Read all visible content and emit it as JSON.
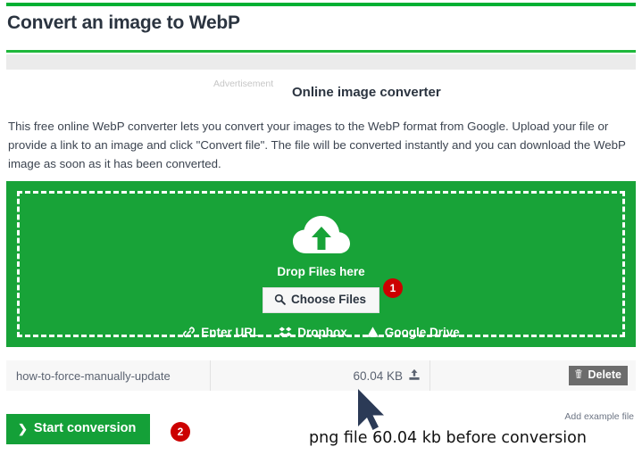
{
  "header": {
    "title": "Convert an image to WebP"
  },
  "ad": {
    "label": "Advertisement"
  },
  "sub_heading": "Online image converter",
  "intro": "This free online WebP converter lets you convert your images to the WebP format from Google. Upload your file or provide a link to an image and click \"Convert file\". The file will be converted instantly and you can download the WebP image as soon as it has been converted.",
  "dropzone": {
    "cloud_icon": "cloud-upload-icon",
    "drop_text": "Drop Files here",
    "choose_files_label": "Choose Files",
    "choose_files_icon": "search-icon",
    "badge_1": "1",
    "services": [
      {
        "label": "Enter URL",
        "icon": "link-icon"
      },
      {
        "label": "Dropbox",
        "icon": "dropbox-icon"
      },
      {
        "label": "Google Drive",
        "icon": "google-drive-icon"
      }
    ]
  },
  "file_row": {
    "name": "how-to-force-manually-update",
    "size": "60.04 KB",
    "upload_icon": "upload-icon",
    "delete_label": "Delete",
    "delete_icon": "trash-icon"
  },
  "actions": {
    "start_conversion_label": "Start conversion",
    "start_chevron_icon": "chevron-right-icon",
    "badge_2": "2",
    "add_example_file_label": "Add example file"
  },
  "annotation": {
    "cursor_icon": "mouse-cursor-icon",
    "caption": "png file 60.04 kb before conversion"
  },
  "colors": {
    "green": "#18a338",
    "green_rule": "#00b033",
    "badge_red": "#cc0000",
    "delete_grey": "#6c6c6c",
    "band_grey": "#ebebeb",
    "cursor_navy": "#2b3a56"
  }
}
